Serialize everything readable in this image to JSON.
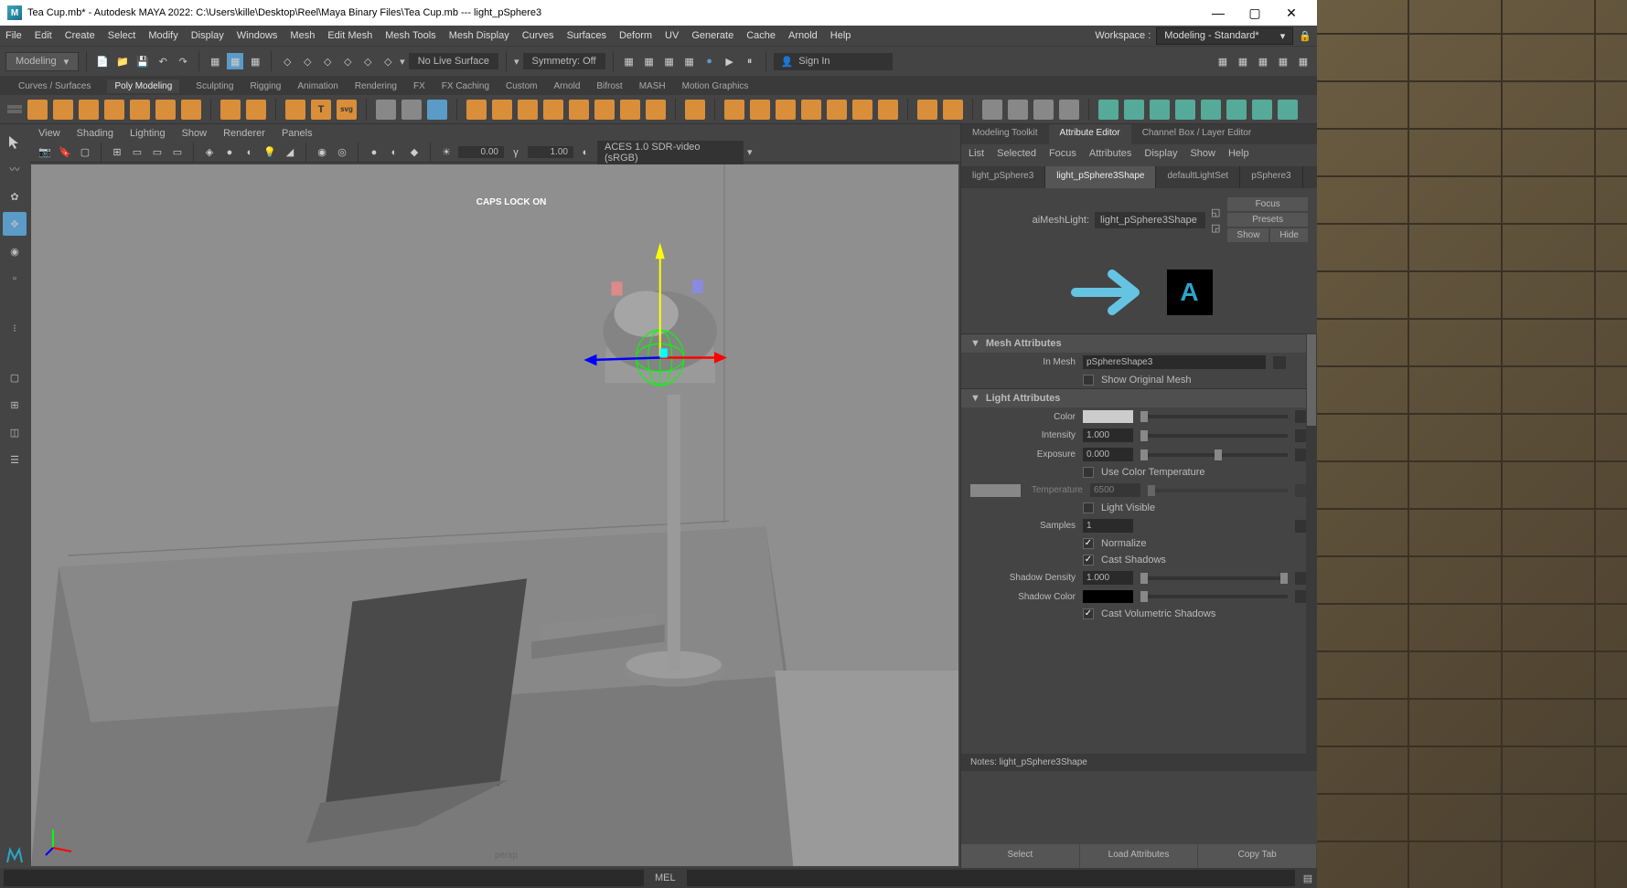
{
  "titlebar": {
    "title": "Tea Cup.mb* - Autodesk MAYA 2022: C:\\Users\\kille\\Desktop\\Reel\\Maya Binary Files\\Tea Cup.mb   ---   light_pSphere3"
  },
  "menubar": {
    "items": [
      "File",
      "Edit",
      "Create",
      "Select",
      "Modify",
      "Display",
      "Windows",
      "Mesh",
      "Edit Mesh",
      "Mesh Tools",
      "Mesh Display",
      "Curves",
      "Surfaces",
      "Deform",
      "UV",
      "Generate",
      "Cache",
      "Arnold",
      "Help"
    ],
    "workspace_label": "Workspace :",
    "workspace_value": "Modeling - Standard*"
  },
  "toolbar": {
    "mode": "Modeling",
    "live": "No Live Surface",
    "symmetry": "Symmetry: Off",
    "signin": "Sign In"
  },
  "shelf": {
    "tabs": [
      "Curves / Surfaces",
      "Poly Modeling",
      "Sculpting",
      "Rigging",
      "Animation",
      "Rendering",
      "FX",
      "FX Caching",
      "Custom",
      "Arnold",
      "Bifrost",
      "MASH",
      "Motion Graphics"
    ],
    "active": "Poly Modeling"
  },
  "viewport": {
    "menus": [
      "View",
      "Shading",
      "Lighting",
      "Show",
      "Renderer",
      "Panels"
    ],
    "num1": "0.00",
    "num2": "1.00",
    "colorspace": "ACES 1.0 SDR-video (sRGB)",
    "caps": "CAPS LOCK ON",
    "camera": "persp"
  },
  "right": {
    "tabs": [
      "Modeling Toolkit",
      "Attribute Editor",
      "Channel Box / Layer Editor"
    ],
    "active_tab": "Attribute Editor",
    "menu": [
      "List",
      "Selected",
      "Focus",
      "Attributes",
      "Display",
      "Show",
      "Help"
    ],
    "objtabs": [
      "light_pSphere3",
      "light_pSphere3Shape",
      "defaultLightSet",
      "pSphere3"
    ],
    "active_objtab": "light_pSphere3Shape",
    "node_type": "aiMeshLight:",
    "node_name": "light_pSphere3Shape",
    "btns": {
      "focus": "Focus",
      "presets": "Presets",
      "show": "Show",
      "hide": "Hide"
    },
    "mesh_attrs": {
      "title": "Mesh Attributes",
      "in_mesh_label": "In Mesh",
      "in_mesh": "pSphereShape3",
      "show_orig": "Show Original Mesh"
    },
    "light_attrs": {
      "title": "Light Attributes",
      "color": "Color",
      "intensity": "Intensity",
      "intensity_v": "1.000",
      "exposure": "Exposure",
      "exposure_v": "0.000",
      "use_temp": "Use Color Temperature",
      "temp": "Temperature",
      "temp_v": "6500",
      "light_visible": "Light Visible",
      "samples": "Samples",
      "samples_v": "1",
      "normalize": "Normalize",
      "cast_shadows": "Cast Shadows",
      "shadow_density": "Shadow Density",
      "shadow_density_v": "1.000",
      "shadow_color": "Shadow Color",
      "cast_vol": "Cast Volumetric Shadows"
    },
    "notes_label": "Notes:  light_pSphere3Shape",
    "bottom": {
      "select": "Select",
      "load": "Load Attributes",
      "copy": "Copy Tab"
    }
  },
  "statusbar": {
    "mel": "MEL"
  }
}
